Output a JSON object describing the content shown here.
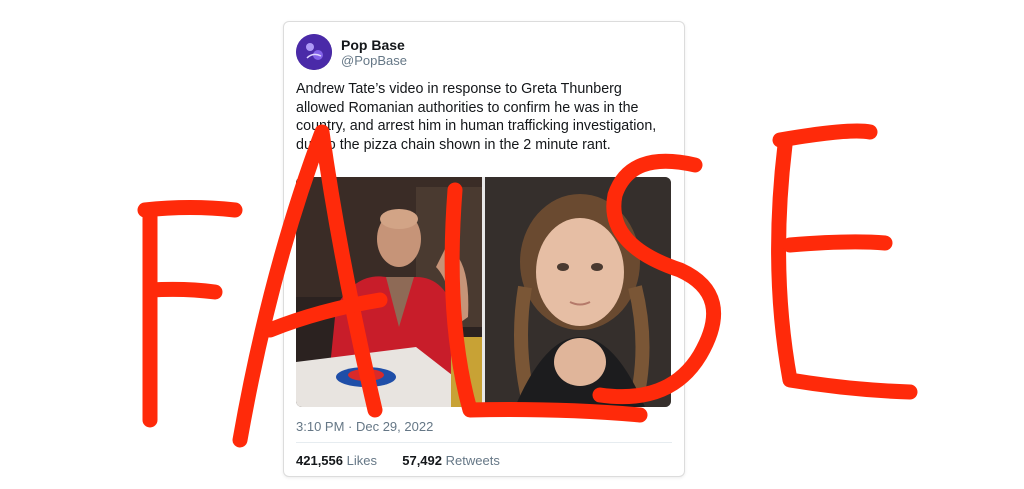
{
  "tweet": {
    "display_name": "Pop Base",
    "handle": "@PopBase",
    "text": "Andrew Tate’s video in response to Greta Thunberg allowed Romanian authorities to confirm he was in the country, and arrest him in human trafficking investigation, due to the pizza chain shown in the 2 minute rant.",
    "timestamp": "3:10 PM · Dec 29, 2022",
    "likes_count": "421,556",
    "likes_label": "Likes",
    "retweets_count": "57,492",
    "retweets_label": "Retweets",
    "avatar_icon": "pop-base-logo",
    "media": [
      "andrew-tate-photo",
      "greta-thunberg-photo"
    ]
  },
  "overlay": {
    "stamp_text": "FALSE",
    "stamp_color": "#ff2a0a"
  }
}
